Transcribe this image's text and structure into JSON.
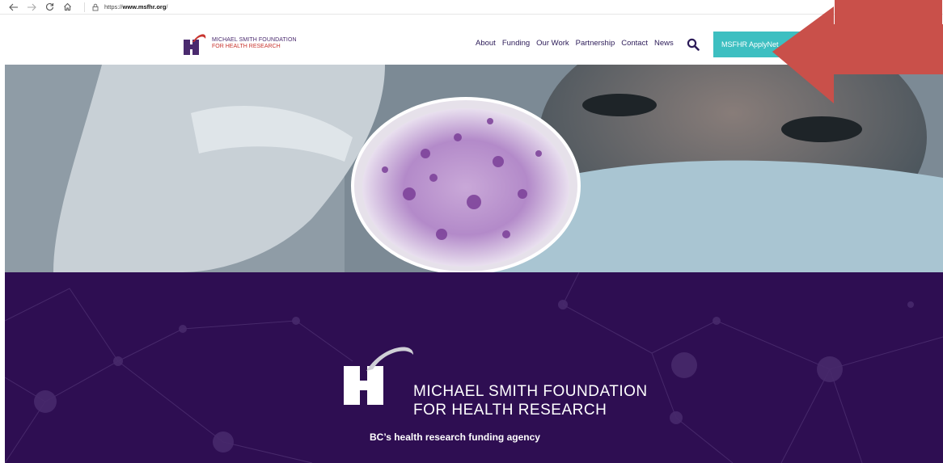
{
  "browser": {
    "back_icon": "arrow-left-icon",
    "forward_icon": "arrow-right-icon",
    "refresh_icon": "refresh-icon",
    "home_icon": "home-icon",
    "url_prefix": "https://",
    "url_host": "www.msfhr.org",
    "url_path": "/"
  },
  "header": {
    "logo_line1": "MICHAEL SMITH FOUNDATION",
    "logo_line2": "FOR HEALTH RESEARCH",
    "nav": [
      "About",
      "Funding",
      "Our Work",
      "Partnership",
      "Contact",
      "News"
    ],
    "apply_label": "MSFHR ApplyNet"
  },
  "banner": {
    "title_line1": "MICHAEL SMITH FOUNDATION",
    "title_line2": "FOR HEALTH RESEARCH",
    "tagline": "BC’s health research funding agency"
  },
  "colors": {
    "brand_purple": "#2e0e52",
    "brand_red": "#c8352f",
    "apply_teal": "#3dbfc1",
    "annotation_arrow": "#c9504a"
  }
}
